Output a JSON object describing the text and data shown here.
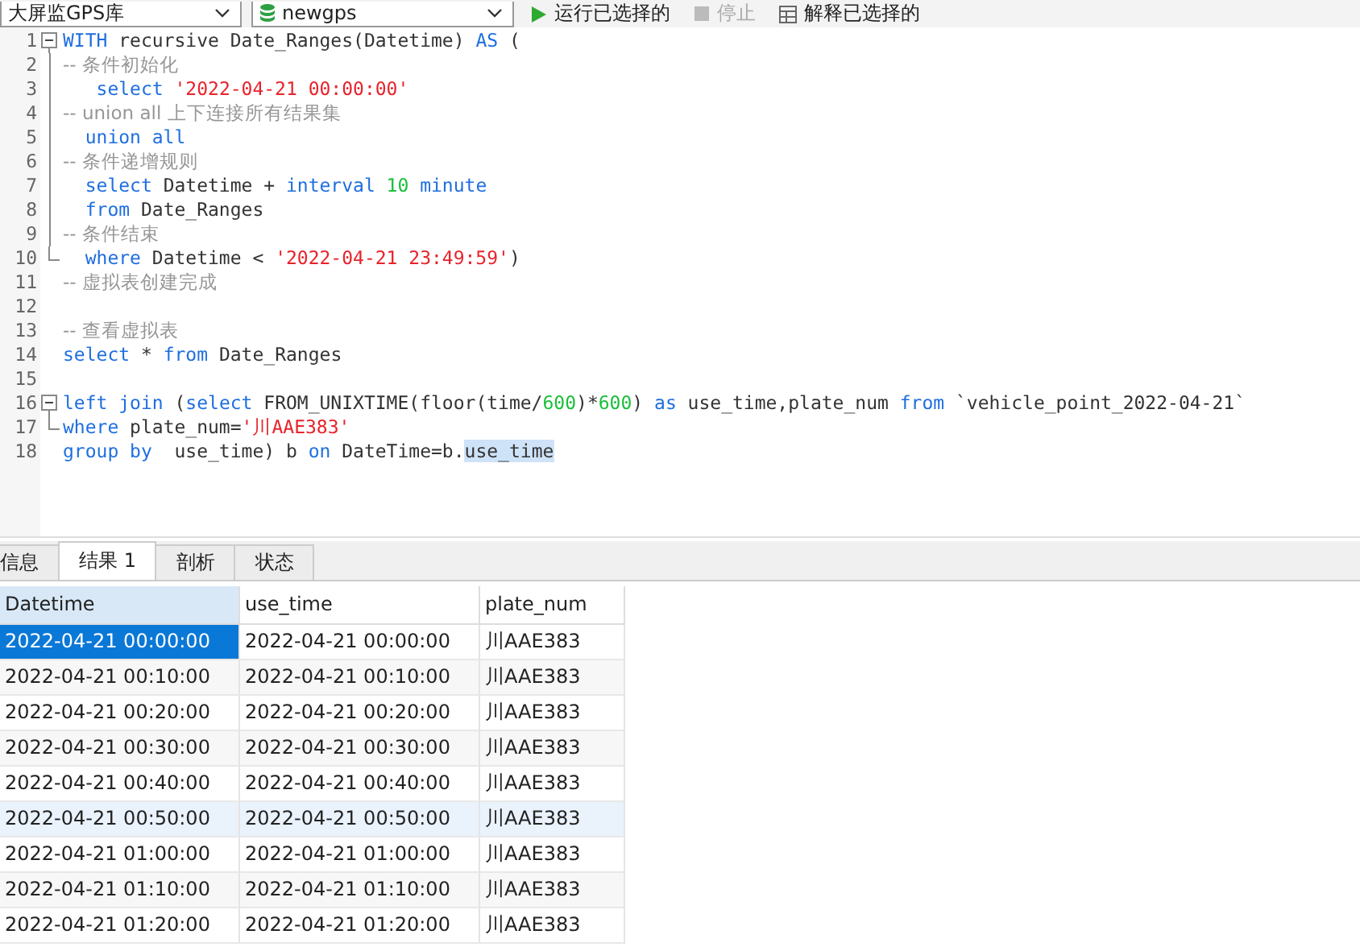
{
  "toolbar": {
    "database_select": "大屏监GPS库",
    "schema_select": "newgps",
    "actions": [
      {
        "label": "运行已选择的",
        "kind": "run",
        "disabled": false
      },
      {
        "label": "停止",
        "kind": "stop",
        "disabled": true
      },
      {
        "label": "解释已选择的",
        "kind": "explain",
        "disabled": false
      }
    ]
  },
  "editor": {
    "lines": [
      {
        "number": "1",
        "kind": "fold-start",
        "tokens": [
          {
            "kind": "keyword",
            "text": "WITH"
          },
          {
            "kind": "plain",
            "text": " recursive Date_Ranges(Datetime) "
          },
          {
            "kind": "keyword",
            "text": "AS"
          },
          {
            "kind": "plain",
            "text": " ("
          }
        ]
      },
      {
        "number": "2",
        "kind": "fold-body",
        "tokens": [
          {
            "kind": "comment",
            "text": "-- 条件初始化"
          }
        ]
      },
      {
        "number": "3",
        "kind": "fold-body",
        "tokens": [
          {
            "kind": "keyword",
            "text": "   select "
          },
          {
            "kind": "string",
            "text": "'2022-04-21 00:00:00'"
          }
        ]
      },
      {
        "number": "4",
        "kind": "fold-body",
        "tokens": [
          {
            "kind": "comment",
            "text": "-- union all 上下连接所有结果集"
          }
        ]
      },
      {
        "number": "5",
        "kind": "fold-body",
        "tokens": [
          {
            "kind": "keyword",
            "text": "  union all"
          }
        ]
      },
      {
        "number": "6",
        "kind": "fold-body",
        "tokens": [
          {
            "kind": "comment",
            "text": "-- 条件递增规则"
          }
        ]
      },
      {
        "number": "7",
        "kind": "fold-body",
        "tokens": [
          {
            "kind": "keyword",
            "text": "  select"
          },
          {
            "kind": "plain",
            "text": " Datetime + "
          },
          {
            "kind": "keyword",
            "text": "interval "
          },
          {
            "kind": "number",
            "text": "10"
          },
          {
            "kind": "keyword",
            "text": " minute"
          }
        ]
      },
      {
        "number": "8",
        "kind": "fold-body",
        "tokens": [
          {
            "kind": "keyword",
            "text": "  from"
          },
          {
            "kind": "plain",
            "text": " Date_Ranges"
          }
        ]
      },
      {
        "number": "9",
        "kind": "fold-body",
        "tokens": [
          {
            "kind": "comment",
            "text": "-- 条件结束"
          }
        ]
      },
      {
        "number": "10",
        "kind": "fold-end",
        "tokens": [
          {
            "kind": "keyword",
            "text": "  where"
          },
          {
            "kind": "plain",
            "text": " Datetime < "
          },
          {
            "kind": "string",
            "text": "'2022-04-21 23:49:59'"
          },
          {
            "kind": "plain",
            "text": ")"
          }
        ]
      },
      {
        "number": "11",
        "kind": "plain",
        "tokens": [
          {
            "kind": "comment",
            "text": "-- 虚拟表创建完成"
          }
        ]
      },
      {
        "number": "12",
        "kind": "plain"
      },
      {
        "number": "13",
        "kind": "plain",
        "tokens": [
          {
            "kind": "comment",
            "text": "-- 查看虚拟表"
          }
        ]
      },
      {
        "number": "14",
        "kind": "plain",
        "tokens": [
          {
            "kind": "keyword",
            "text": "select"
          },
          {
            "kind": "plain",
            "text": " * "
          },
          {
            "kind": "keyword",
            "text": "from"
          },
          {
            "kind": "plain",
            "text": " Date_Ranges"
          }
        ]
      },
      {
        "number": "15",
        "kind": "plain"
      },
      {
        "number": "16",
        "kind": "fold-start",
        "tokens": [
          {
            "kind": "keyword",
            "text": "left join"
          },
          {
            "kind": "plain",
            "text": " ("
          },
          {
            "kind": "keyword",
            "text": "select"
          },
          {
            "kind": "plain",
            "text": " FROM_UNIXTIME(floor(time/"
          },
          {
            "kind": "number",
            "text": "600"
          },
          {
            "kind": "plain",
            "text": ")*"
          },
          {
            "kind": "number",
            "text": "600"
          },
          {
            "kind": "plain",
            "text": ") "
          },
          {
            "kind": "keyword",
            "text": "as"
          },
          {
            "kind": "plain",
            "text": " use_time,plate_num "
          },
          {
            "kind": "keyword",
            "text": "from"
          },
          {
            "kind": "plain",
            "text": " `vehicle_point_2022-04-21`"
          }
        ]
      },
      {
        "number": "17",
        "kind": "fold-end",
        "tokens": [
          {
            "kind": "keyword",
            "text": "where"
          },
          {
            "kind": "plain",
            "text": " plate_num="
          },
          {
            "kind": "string",
            "text": "'川AAE383'"
          }
        ]
      },
      {
        "number": "18",
        "kind": "plain",
        "tokens": [
          {
            "kind": "keyword",
            "text": "group by"
          },
          {
            "kind": "plain",
            "text": "  use_time) b "
          },
          {
            "kind": "keyword",
            "text": "on"
          },
          {
            "kind": "plain",
            "text": " DateTime=b."
          },
          {
            "kind": "selection",
            "text": "use_time"
          }
        ]
      }
    ]
  },
  "result_tabs": [
    {
      "label": "信息",
      "selected": false
    },
    {
      "label": "结果 1",
      "selected": true
    },
    {
      "label": "剖析",
      "selected": false
    },
    {
      "label": "状态",
      "selected": false
    }
  ],
  "table": {
    "columns": [
      {
        "label": "Datetime",
        "selected": true
      },
      {
        "label": "use_time",
        "selected": false
      },
      {
        "label": "plate_num",
        "selected": false
      }
    ],
    "rows": [
      {
        "cells": [
          "2022-04-21 00:00:00",
          "2022-04-21 00:00:00",
          "川AAE383"
        ],
        "selected": true,
        "hovered": false
      },
      {
        "cells": [
          "2022-04-21 00:10:00",
          "2022-04-21 00:10:00",
          "川AAE383"
        ],
        "selected": false,
        "hovered": false
      },
      {
        "cells": [
          "2022-04-21 00:20:00",
          "2022-04-21 00:20:00",
          "川AAE383"
        ],
        "selected": false,
        "hovered": false
      },
      {
        "cells": [
          "2022-04-21 00:30:00",
          "2022-04-21 00:30:00",
          "川AAE383"
        ],
        "selected": false,
        "hovered": false
      },
      {
        "cells": [
          "2022-04-21 00:40:00",
          "2022-04-21 00:40:00",
          "川AAE383"
        ],
        "selected": false,
        "hovered": false
      },
      {
        "cells": [
          "2022-04-21 00:50:00",
          "2022-04-21 00:50:00",
          "川AAE383"
        ],
        "selected": false,
        "hovered": true
      },
      {
        "cells": [
          "2022-04-21 01:00:00",
          "2022-04-21 01:00:00",
          "川AAE383"
        ],
        "selected": false,
        "hovered": false
      },
      {
        "cells": [
          "2022-04-21 01:10:00",
          "2022-04-21 01:10:00",
          "川AAE383"
        ],
        "selected": false,
        "hovered": false
      },
      {
        "cells": [
          "2022-04-21 01:20:00",
          "2022-04-21 01:20:00",
          "川AAE383"
        ],
        "selected": false,
        "hovered": false
      }
    ]
  }
}
